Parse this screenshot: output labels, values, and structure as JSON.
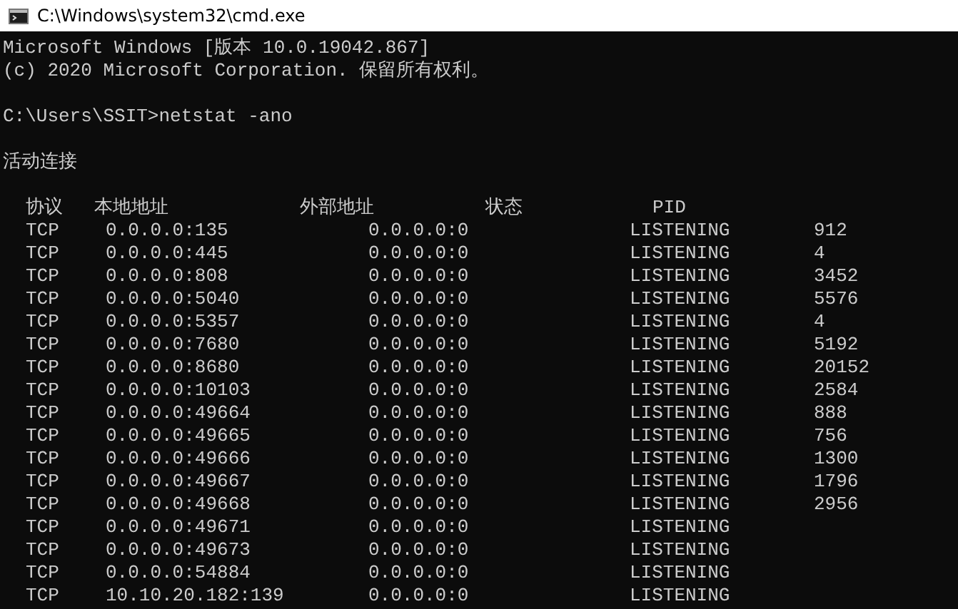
{
  "window": {
    "title": "C:\\Windows\\system32\\cmd.exe"
  },
  "console": {
    "paragraphs": [
      [
        "Microsoft Windows [版本 10.0.19042.867]",
        "(c) 2020 Microsoft Corporation. 保留所有权利。"
      ],
      [
        "C:\\Users\\SSIT>netstat -ano"
      ],
      [
        "活动连接"
      ]
    ],
    "header_labels": [
      "协议",
      "本地地址",
      "外部地址",
      "状态",
      "PID"
    ]
  },
  "table": {
    "rows": [
      [
        "TCP",
        "0.0.0.0:135",
        "0.0.0.0:0",
        "LISTENING",
        "912"
      ],
      [
        "TCP",
        "0.0.0.0:445",
        "0.0.0.0:0",
        "LISTENING",
        "4"
      ],
      [
        "TCP",
        "0.0.0.0:808",
        "0.0.0.0:0",
        "LISTENING",
        "3452"
      ],
      [
        "TCP",
        "0.0.0.0:5040",
        "0.0.0.0:0",
        "LISTENING",
        "5576"
      ],
      [
        "TCP",
        "0.0.0.0:5357",
        "0.0.0.0:0",
        "LISTENING",
        "4"
      ],
      [
        "TCP",
        "0.0.0.0:7680",
        "0.0.0.0:0",
        "LISTENING",
        "5192"
      ],
      [
        "TCP",
        "0.0.0.0:8680",
        "0.0.0.0:0",
        "LISTENING",
        "20152"
      ],
      [
        "TCP",
        "0.0.0.0:10103",
        "0.0.0.0:0",
        "LISTENING",
        "2584"
      ],
      [
        "TCP",
        "0.0.0.0:49664",
        "0.0.0.0:0",
        "LISTENING",
        "888"
      ],
      [
        "TCP",
        "0.0.0.0:49665",
        "0.0.0.0:0",
        "LISTENING",
        "756"
      ],
      [
        "TCP",
        "0.0.0.0:49666",
        "0.0.0.0:0",
        "LISTENING",
        "1300"
      ],
      [
        "TCP",
        "0.0.0.0:49667",
        "0.0.0.0:0",
        "LISTENING",
        "1796"
      ],
      [
        "TCP",
        "0.0.0.0:49668",
        "0.0.0.0:0",
        "LISTENING",
        "2956"
      ],
      [
        "TCP",
        "0.0.0.0:49671",
        "0.0.0.0:0",
        "LISTENING"
      ],
      [
        "TCP",
        "0.0.0.0:49673",
        "0.0.0.0:0",
        "LISTENING"
      ],
      [
        "TCP",
        "0.0.0.0:54884",
        "0.0.0.0:0",
        "LISTENING"
      ],
      [
        "TCP",
        "10.10.20.182:139",
        "0.0.0.0:0",
        "LISTENING"
      ]
    ]
  }
}
